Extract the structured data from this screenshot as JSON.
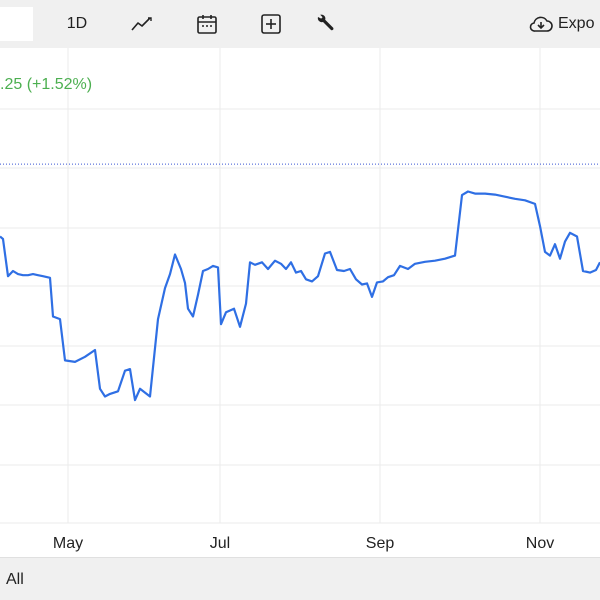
{
  "toolbar": {
    "interval_label": "1D",
    "export_label": "Expo",
    "icons": [
      "line-style-icon",
      "calendar-icon",
      "add-indicator-icon",
      "settings-wrench-icon",
      "cloud-download-icon"
    ]
  },
  "header": {
    "change_text": ".25 (+1.52%)",
    "change_color": "#4caf50"
  },
  "range": {
    "all_label": "All"
  },
  "chart_data": {
    "type": "line",
    "x_tick_labels": [
      "May",
      "Jul",
      "Sep",
      "Nov"
    ],
    "line_color": "#2f6fe4",
    "reference_line": true,
    "grid": true,
    "series": [
      {
        "points": [
          [
            0,
            5.55
          ],
          [
            3,
            5.5
          ],
          [
            8,
            4.78
          ],
          [
            13,
            4.88
          ],
          [
            18,
            4.82
          ],
          [
            23,
            4.8
          ],
          [
            28,
            4.8
          ],
          [
            33,
            4.82
          ],
          [
            38,
            4.8
          ],
          [
            43,
            4.78
          ],
          [
            50,
            4.75
          ],
          [
            53,
            4.0
          ],
          [
            60,
            3.95
          ],
          [
            65,
            3.15
          ],
          [
            75,
            3.12
          ],
          [
            85,
            3.22
          ],
          [
            95,
            3.35
          ],
          [
            100,
            2.6
          ],
          [
            105,
            2.45
          ],
          [
            110,
            2.5
          ],
          [
            118,
            2.55
          ],
          [
            125,
            2.95
          ],
          [
            130,
            2.98
          ],
          [
            135,
            2.38
          ],
          [
            140,
            2.6
          ],
          [
            150,
            2.45
          ],
          [
            158,
            3.95
          ],
          [
            165,
            4.55
          ],
          [
            170,
            4.82
          ],
          [
            175,
            5.2
          ],
          [
            181,
            4.92
          ],
          [
            185,
            4.65
          ],
          [
            188,
            4.15
          ],
          [
            193,
            4.0
          ],
          [
            198,
            4.42
          ],
          [
            203,
            4.88
          ],
          [
            208,
            4.92
          ],
          [
            213,
            4.98
          ],
          [
            218,
            4.95
          ],
          [
            221,
            3.85
          ],
          [
            226,
            4.08
          ],
          [
            234,
            4.15
          ],
          [
            240,
            3.8
          ],
          [
            246,
            4.25
          ],
          [
            250,
            5.05
          ],
          [
            255,
            5.0
          ],
          [
            262,
            5.05
          ],
          [
            268,
            4.92
          ],
          [
            275,
            5.08
          ],
          [
            281,
            5.02
          ],
          [
            286,
            4.92
          ],
          [
            291,
            5.05
          ],
          [
            296,
            4.85
          ],
          [
            301,
            4.88
          ],
          [
            306,
            4.72
          ],
          [
            312,
            4.68
          ],
          [
            318,
            4.78
          ],
          [
            325,
            5.22
          ],
          [
            330,
            5.25
          ],
          [
            337,
            4.9
          ],
          [
            344,
            4.88
          ],
          [
            350,
            4.92
          ],
          [
            356,
            4.72
          ],
          [
            362,
            4.62
          ],
          [
            367,
            4.64
          ],
          [
            372,
            4.38
          ],
          [
            377,
            4.66
          ],
          [
            383,
            4.68
          ],
          [
            388,
            4.76
          ],
          [
            394,
            4.8
          ],
          [
            400,
            4.98
          ],
          [
            408,
            4.92
          ],
          [
            415,
            5.02
          ],
          [
            425,
            5.06
          ],
          [
            435,
            5.08
          ],
          [
            445,
            5.12
          ],
          [
            455,
            5.18
          ],
          [
            462,
            6.35
          ],
          [
            468,
            6.42
          ],
          [
            475,
            6.38
          ],
          [
            485,
            6.38
          ],
          [
            495,
            6.36
          ],
          [
            505,
            6.32
          ],
          [
            515,
            6.28
          ],
          [
            525,
            6.25
          ],
          [
            535,
            6.18
          ],
          [
            540,
            5.75
          ],
          [
            545,
            5.25
          ],
          [
            550,
            5.18
          ],
          [
            555,
            5.4
          ],
          [
            560,
            5.12
          ],
          [
            565,
            5.45
          ],
          [
            570,
            5.62
          ],
          [
            577,
            5.55
          ],
          [
            583,
            4.88
          ],
          [
            590,
            4.85
          ],
          [
            596,
            4.9
          ],
          [
            600,
            5.05
          ]
        ]
      }
    ],
    "reference_value": 6.95,
    "y_range": [
      0,
      9.2
    ]
  }
}
